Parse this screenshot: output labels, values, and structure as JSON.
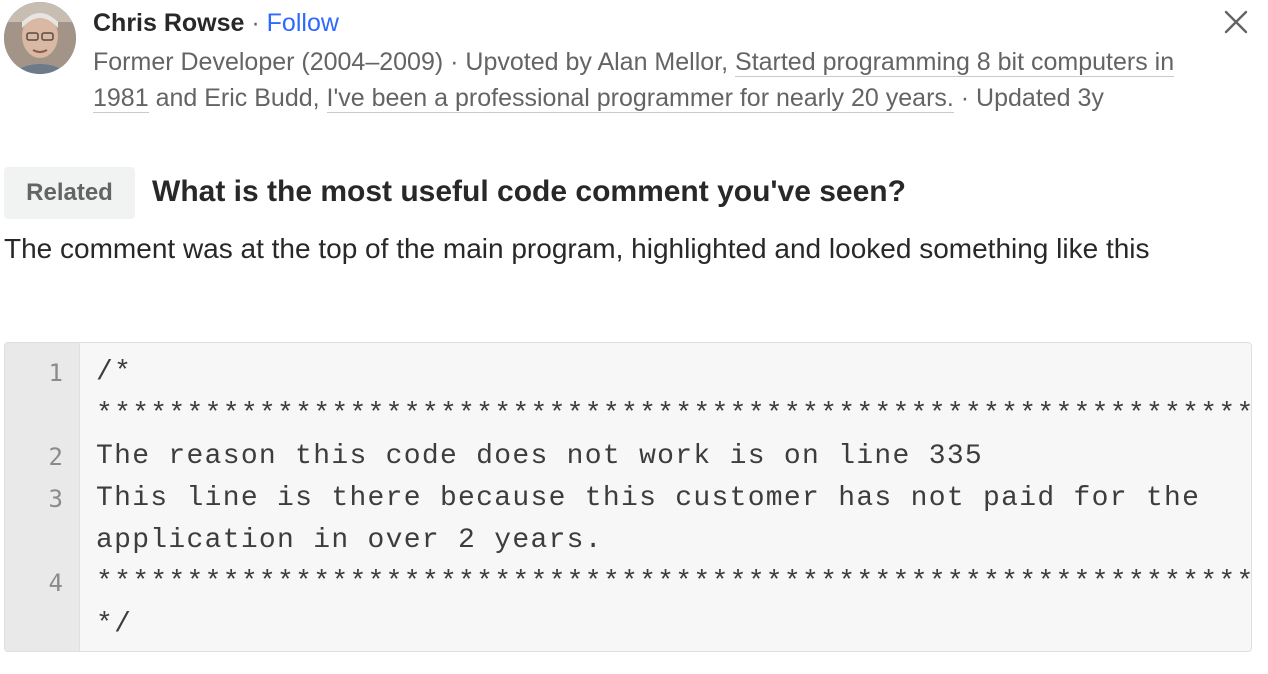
{
  "author": {
    "name": "Chris Rowse",
    "separator": " · ",
    "follow_label": "Follow",
    "avatar_icon": "user-avatar"
  },
  "credentials": {
    "role": "Former Developer (2004–2009)",
    "upvoted_prefix": " · Upvoted by ",
    "upvoter1_name": "Alan Mellor",
    "upvoter1_cred": "Started programming 8 bit computers in 1981",
    "and_text": " and ",
    "upvoter2_name": "Eric Budd",
    "upvoter2_cred": "I've been a professional programmer for nearly 20 years.",
    "updated": " · Updated 3y"
  },
  "close_icon": "close-icon",
  "related": {
    "badge": "Related",
    "question": "What is the most useful code comment you've seen?"
  },
  "answer": {
    "intro": "The comment was at the top of the main program, highlighted and looked something like this"
  },
  "code": {
    "line_numbers": [
      "1",
      "2",
      "3",
      "4"
    ],
    "lines": [
      "/*",
      "***************************************************************************",
      "The reason this code does not work is on line 335",
      "This line is there because this customer has not paid for the",
      "application in over 2 years.",
      "***************************************************************************",
      "*/"
    ]
  },
  "colors": {
    "follow": "#2e69ff",
    "meta": "#636466",
    "text": "#282829",
    "code_bg": "#f7f7f7",
    "gutter_bg": "#e9e9e9"
  }
}
